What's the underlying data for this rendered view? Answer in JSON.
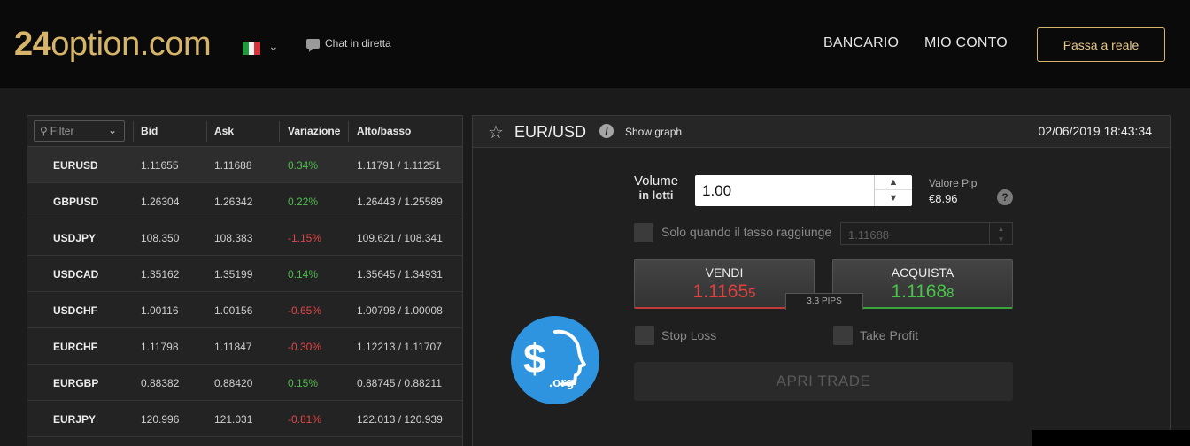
{
  "header": {
    "logo_num": "24",
    "logo_rest": "option.com",
    "chat": "Chat in diretta",
    "nav": [
      "BANCARIO",
      "MIO CONTO"
    ],
    "cta": "Passa a reale"
  },
  "table": {
    "filter_placeholder": "Filter",
    "headers": [
      "Bid",
      "Ask",
      "Variazione",
      "Alto/basso"
    ],
    "rows": [
      {
        "sym": "EURUSD",
        "bid": "1.11655",
        "ask": "1.11688",
        "chg": "0.34%",
        "dir": "pos",
        "hl": "1.11791 / 1.11251"
      },
      {
        "sym": "GBPUSD",
        "bid": "1.26304",
        "ask": "1.26342",
        "chg": "0.22%",
        "dir": "pos",
        "hl": "1.26443 / 1.25589"
      },
      {
        "sym": "USDJPY",
        "bid": "108.350",
        "ask": "108.383",
        "chg": "-1.15%",
        "dir": "neg",
        "hl": "109.621 / 108.341"
      },
      {
        "sym": "USDCAD",
        "bid": "1.35162",
        "ask": "1.35199",
        "chg": "0.14%",
        "dir": "pos",
        "hl": "1.35645 / 1.34931"
      },
      {
        "sym": "USDCHF",
        "bid": "1.00116",
        "ask": "1.00156",
        "chg": "-0.65%",
        "dir": "neg",
        "hl": "1.00798 / 1.00008"
      },
      {
        "sym": "EURCHF",
        "bid": "1.11798",
        "ask": "1.11847",
        "chg": "-0.30%",
        "dir": "neg",
        "hl": "1.12213 / 1.11707"
      },
      {
        "sym": "EURGBP",
        "bid": "0.88382",
        "ask": "0.88420",
        "chg": "0.15%",
        "dir": "pos",
        "hl": "0.88745 / 0.88211"
      },
      {
        "sym": "EURJPY",
        "bid": "120.996",
        "ask": "121.031",
        "chg": "-0.81%",
        "dir": "neg",
        "hl": "122.013 / 120.939"
      }
    ]
  },
  "trade": {
    "pair": "EUR/USD",
    "show_graph": "Show graph",
    "datetime": "02/06/2019 18:43:34",
    "volume_label": "Volume",
    "volume_sub": "in lotti",
    "volume_value": "1.00",
    "pip_label": "Valore Pip",
    "pip_value": "€8.96",
    "rate_label": "Solo quando il tasso raggiunge",
    "rate_value": "1.11688",
    "sell_label": "VENDI",
    "sell_main": "1.1165",
    "sell_last": "5",
    "buy_label": "ACQUISTA",
    "buy_main": "1.1168",
    "buy_last": "8",
    "pips": "3.3 PIPS",
    "stop_loss": "Stop Loss",
    "take_profit": "Take Profit",
    "open_trade": "APRI TRADE"
  },
  "watermark": {
    "text": ".org"
  },
  "colors": {
    "gold": "#d6b46a",
    "positive": "#4bbd4b",
    "negative": "#e04848",
    "badge": "#2e94e0"
  }
}
